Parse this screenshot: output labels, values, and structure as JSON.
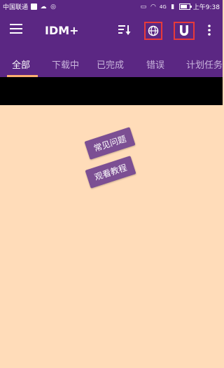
{
  "status_bar": {
    "carrier": "中国联通",
    "network": "4G",
    "time": "上午9:38"
  },
  "toolbar": {
    "title": "IDM+"
  },
  "tabs": [
    {
      "label": "全部"
    },
    {
      "label": "下载中"
    },
    {
      "label": "已完成"
    },
    {
      "label": "错误"
    },
    {
      "label": "计划任务"
    }
  ],
  "chips": {
    "faq": "常见问题",
    "tutorial": "观看教程"
  },
  "icons": {
    "menu": "menu-icon",
    "sort": "sort-icon",
    "globe": "globe-icon",
    "magnet": "magnet-icon",
    "more": "more-vert-icon"
  },
  "colors": {
    "primary": "#5b2783",
    "accent_indicator": "#ffb070",
    "highlight_border": "#e83a3a",
    "content_bg": "#ffdcb9",
    "chip_bg": "#7c4f93"
  }
}
